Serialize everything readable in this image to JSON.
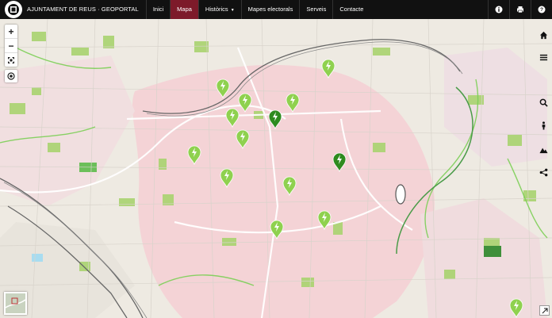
{
  "header": {
    "brand": "AJUNTAMENT DE REUS · GEOPORTAL",
    "nav": [
      {
        "label": "Inici",
        "active": false
      },
      {
        "label": "Mapa",
        "active": true
      },
      {
        "label": "Històrics",
        "active": false,
        "dropdown": true
      },
      {
        "label": "Mapes electorals",
        "active": false
      },
      {
        "label": "Serveis",
        "active": false
      },
      {
        "label": "Contacte",
        "active": false
      }
    ],
    "tools": [
      "info-icon",
      "print-icon",
      "help-icon"
    ]
  },
  "map_controls": {
    "zoom_in": "+",
    "zoom_out": "−",
    "full_extent": "expand-icon",
    "locate": "locate-icon"
  },
  "right_toolbar": [
    "home-icon",
    "menu-icon",
    "search-icon",
    "street-view-icon",
    "elevation-icon",
    "share-icon"
  ],
  "colors": {
    "header_bg": "#111111",
    "active_nav": "#7d1a2a",
    "marker": "#8fd14f",
    "marker_dark": "#2e8b1f"
  }
}
